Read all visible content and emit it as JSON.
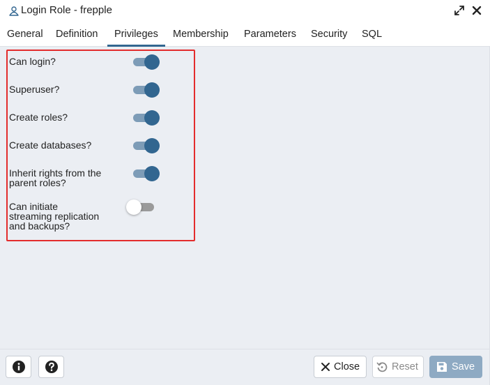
{
  "dialog": {
    "title": "Login Role - frepple",
    "title_icon": "user-role-icon"
  },
  "window_controls": {
    "maximize_icon": "maximize-icon",
    "close_icon": "close-icon"
  },
  "tabs": [
    {
      "label": "General",
      "active": false
    },
    {
      "label": "Definition",
      "active": false
    },
    {
      "label": "Privileges",
      "active": true
    },
    {
      "label": "Membership",
      "active": false
    },
    {
      "label": "Parameters",
      "active": false
    },
    {
      "label": "Security",
      "active": false
    },
    {
      "label": "SQL",
      "active": false
    }
  ],
  "privileges": [
    {
      "lines": [
        "Can login?"
      ],
      "enabled": true
    },
    {
      "lines": [
        "Superuser?"
      ],
      "enabled": true
    },
    {
      "lines": [
        "Create roles?"
      ],
      "enabled": true
    },
    {
      "lines": [
        "Create databases?"
      ],
      "enabled": true
    },
    {
      "lines": [
        "Inherit rights from the",
        "parent roles?"
      ],
      "enabled": true
    },
    {
      "lines": [
        "Can initiate",
        "streaming replication",
        "and backups?"
      ],
      "enabled": false
    }
  ],
  "footer": {
    "info_icon": "info-icon",
    "help_icon": "help-icon",
    "close_label": "Close",
    "reset_label": "Reset",
    "save_label": "Save"
  },
  "colors": {
    "accent": "#326690",
    "highlight_border": "#e32c2c",
    "content_bg": "#ebeef3",
    "save_disabled_bg": "#8eaac3"
  }
}
